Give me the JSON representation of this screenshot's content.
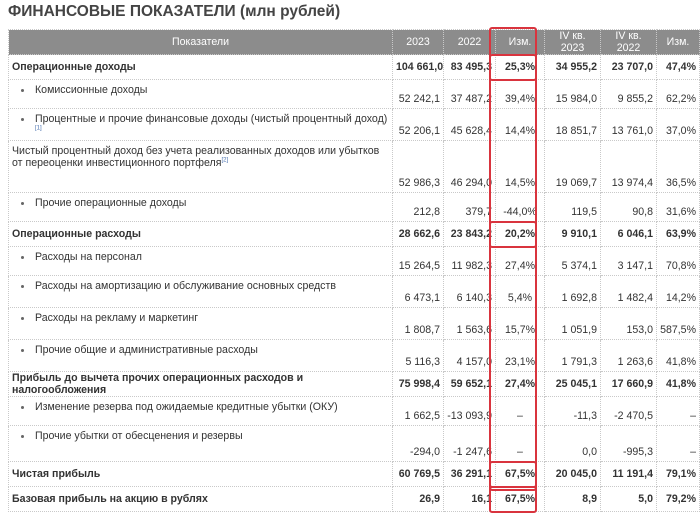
{
  "title": "ФИНАНСОВЫЕ ПОКАЗАТЕЛИ (млн рублей)",
  "headers": [
    "Показатели",
    "2023",
    "2022",
    "Изм.",
    "IV кв. 2023",
    "IV кв. 2022",
    "Изм."
  ],
  "rows": [
    {
      "label": "Операционные доходы",
      "bold": true,
      "c1": "104 661,0",
      "c2": "83 495,3",
      "c3": "25,3%",
      "c4": "34 955,2",
      "c5": "23 707,0",
      "c6": "47,4%"
    },
    {
      "label": "Комиссионные доходы",
      "sub": true,
      "c1": "52 242,1",
      "c2": "37 487,2",
      "c3": "39,4%",
      "c4": "15 984,0",
      "c5": "9 855,2",
      "c6": "62,2%"
    },
    {
      "label": "Процентные и прочие финансовые доходы (чистый процентный доход)",
      "sup": "[1]",
      "sub": true,
      "c1": "52 206,1",
      "c2": "45 628,4",
      "c3": "14,4%",
      "c4": "18 851,7",
      "c5": "13 761,0",
      "c6": "37,0%"
    },
    {
      "label": "Чистый процентный доход без учета реализованных доходов или убытков от переоценки инвестиционного портфеля",
      "sup": "[2]",
      "c1": "52 986,3",
      "c2": "46 294,0",
      "c3": "14,5%",
      "c4": "19 069,7",
      "c5": "13 974,4",
      "c6": "36,5%"
    },
    {
      "label": "Прочие операционные доходы",
      "sub": true,
      "c1": "212,8",
      "c2": "379,7",
      "c3": "-44,0%",
      "c4": "119,5",
      "c5": "90,8",
      "c6": "31,6%"
    },
    {
      "label": "Операционные расходы",
      "bold": true,
      "c1": "28 662,6",
      "c2": "23 843,2",
      "c3": "20,2%",
      "c4": "9 910,1",
      "c5": "6 046,1",
      "c6": "63,9%"
    },
    {
      "label": "Расходы на персонал",
      "sub": true,
      "c1": "15 264,5",
      "c2": "11 982,3",
      "c3": "27,4%",
      "c4": "5 374,1",
      "c5": "3 147,1",
      "c6": "70,8%"
    },
    {
      "label": "Расходы на амортизацию и обслуживание основных средств",
      "sub": true,
      "c1": "6 473,1",
      "c2": "6 140,3",
      "c3": "5,4%",
      "c4": "1 692,8",
      "c5": "1 482,4",
      "c6": "14,2%"
    },
    {
      "label": "Расходы на рекламу и маркетинг",
      "sub": true,
      "c1": "1 808,7",
      "c2": "1 563,6",
      "c3": "15,7%",
      "c4": "1 051,9",
      "c5": "153,0",
      "c6": "587,5%"
    },
    {
      "label": "Прочие общие и административные расходы",
      "sub": true,
      "c1": "5 116,3",
      "c2": "4 157,0",
      "c3": "23,1%",
      "c4": "1 791,3",
      "c5": "1 263,6",
      "c6": "41,8%"
    },
    {
      "label": "Прибыль до вычета прочих операционных расходов и налогообложения",
      "bold": true,
      "c1": "75 998,4",
      "c2": "59 652,1",
      "c3": "27,4%",
      "c4": "25 045,1",
      "c5": "17 660,9",
      "c6": "41,8%"
    },
    {
      "label": "Изменение резерва под ожидаемые кредитные убытки (ОКУ)",
      "sub": true,
      "c1": "1 662,5",
      "c2": "-13 093,9",
      "c3": "–",
      "c4": "-11,3",
      "c5": "-2 470,5",
      "c6": "–"
    },
    {
      "label": "Прочие убытки от обесценения и резервы",
      "sub": true,
      "c1": "-294,0",
      "c2": "-1 247,6",
      "c3": "–",
      "c4": "0,0",
      "c5": "-995,3",
      "c6": "–"
    },
    {
      "label": "Чистая прибыль",
      "bold": true,
      "c1": "60 769,5",
      "c2": "36 291,1",
      "c3": "67,5%",
      "c4": "20 045,0",
      "c5": "11 191,4",
      "c6": "79,1%"
    },
    {
      "label": "Базовая прибыль на акцию в рублях",
      "bold": true,
      "c1": "26,9",
      "c2": "16,1",
      "c3": "67,5%",
      "c4": "8,9",
      "c5": "5,0",
      "c6": "79,2%"
    }
  ],
  "colors": {
    "header_bg": "#8c8c8c",
    "highlight": "#d9343e",
    "footnote": "#4a72b0"
  }
}
